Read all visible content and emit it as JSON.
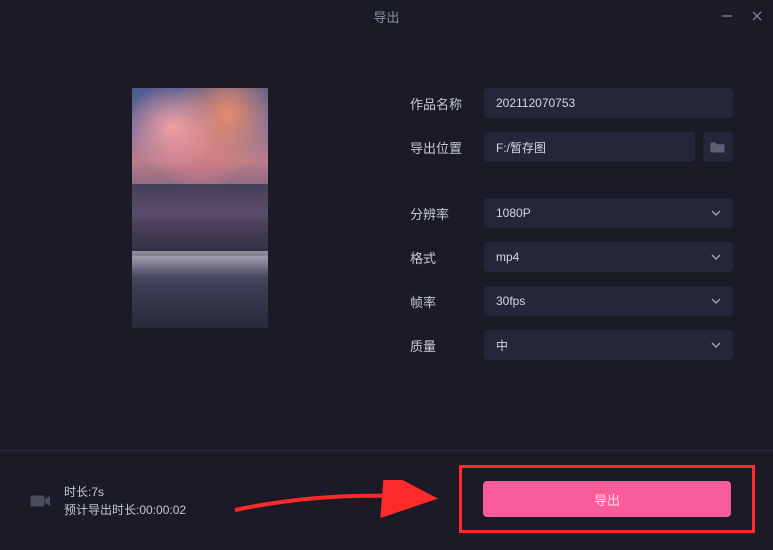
{
  "titlebar": {
    "title": "导出"
  },
  "form": {
    "name_label": "作品名称",
    "name_value": "202112070753",
    "path_label": "导出位置",
    "path_value": "F:/暂存图",
    "resolution_label": "分辨率",
    "resolution_value": "1080P",
    "format_label": "格式",
    "format_value": "mp4",
    "fps_label": "帧率",
    "fps_value": "30fps",
    "quality_label": "质量",
    "quality_value": "中"
  },
  "footer": {
    "duration_line": "时长:7s",
    "eta_line": "预计导出时长:00:00:02",
    "export_label": "导出"
  }
}
